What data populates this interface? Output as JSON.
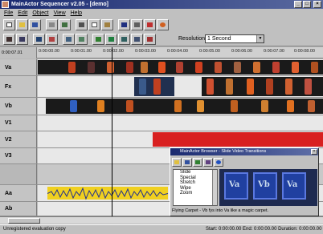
{
  "window": {
    "title": "MainActor Sequencer v2.05 - [demo]",
    "controls": [
      "_",
      "□",
      "×"
    ]
  },
  "menu": [
    "File",
    "Edit",
    "Object",
    "View",
    "Help"
  ],
  "toolbar": {
    "row1_icons": [
      "new-icon",
      "open-icon",
      "save-icon",
      "print-icon",
      "undo-icon",
      "cut-icon",
      "copy-icon",
      "paste-icon",
      "zoom-icon",
      "mixer-icon",
      "marker-icon",
      "render-icon"
    ],
    "row2_icons": [
      "split-icon",
      "join-icon",
      "trim-icon",
      "effect-icon",
      "transition-icon",
      "clip-a-icon",
      "clip-b-icon",
      "audio-icon",
      "title-icon",
      "preview-icon",
      "play-icon"
    ],
    "resolution_label": "Resolution",
    "resolution_value": "1 Second"
  },
  "ruler": {
    "position": "0:00:07.01",
    "ticks": [
      "0:00:00.00",
      "0:00:01.00",
      "0:00:02.00",
      "0:00:03.00",
      "0:00:04.00",
      "0:00:05.00",
      "0:00:06.00",
      "0:00:07.00",
      "0:00:08.00"
    ]
  },
  "tracks": [
    {
      "name": "Va",
      "type": "video"
    },
    {
      "name": "Fx",
      "type": "effect"
    },
    {
      "name": "Vb",
      "type": "video"
    },
    {
      "name": "V1",
      "type": "video"
    },
    {
      "name": "V2",
      "type": "video"
    },
    {
      "name": "V3",
      "type": "video"
    },
    {
      "name": "Aa",
      "type": "audio"
    },
    {
      "name": "Ab",
      "type": "audio"
    }
  ],
  "colors": {
    "title_bar": "#1a2a70",
    "red_clip": "#d82020",
    "audio_wave": "#f0d020",
    "clip_bg": "#1a1a1a"
  },
  "browser": {
    "title": "MainActor Browser - Slide Video Transitions",
    "list_items": [
      "Slide",
      "Special",
      "Stretch",
      "Wipe",
      "Zoom"
    ],
    "thumbnails": [
      "Va",
      "Vb",
      "Va"
    ],
    "status": "Flying Carpet - Vb fys into Va like a magic carpet."
  },
  "status": {
    "left": "Unregistered evaluation copy",
    "right": "Start: 0:00:00.00  End: 0:00:00.00  Duration: 0:00:00.00"
  }
}
